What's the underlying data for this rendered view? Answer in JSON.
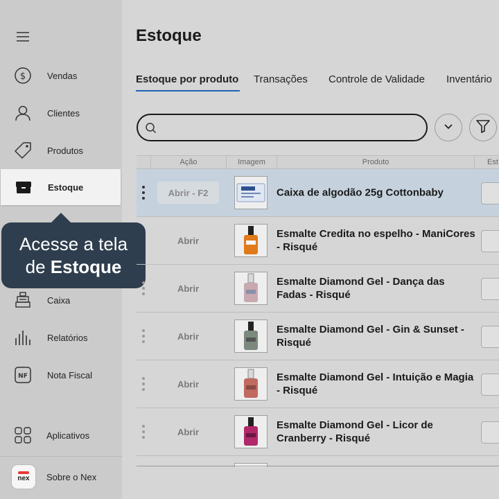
{
  "sidebar": {
    "menu_icon": "hamburger-icon",
    "items": [
      {
        "label": "Vendas",
        "icon": "dollar-circle-icon"
      },
      {
        "label": "Clientes",
        "icon": "user-icon"
      },
      {
        "label": "Produtos",
        "icon": "tag-icon"
      },
      {
        "label": "Estoque",
        "icon": "box-icon",
        "active": true
      },
      {
        "label": "Caixa",
        "icon": "cash-register-icon"
      },
      {
        "label": "Relatórios",
        "icon": "bar-chart-icon"
      },
      {
        "label": "Nota Fiscal",
        "icon": "nf-icon"
      }
    ],
    "apps_label": "Aplicativos",
    "about_label": "Sobre o Nex",
    "logo_text": "nex"
  },
  "tooltip": {
    "line1": "Acesse a tela",
    "line2_prefix": "de",
    "line2_strong": "Estoque"
  },
  "page": {
    "title": "Estoque",
    "tabs": [
      "Estoque por produto",
      "Transações",
      "Controle de Validade",
      "Inventário"
    ],
    "active_tab": 0
  },
  "search": {
    "placeholder": ""
  },
  "table": {
    "columns": [
      "Ação",
      "Imagem",
      "Produto",
      "Est"
    ],
    "rows": [
      {
        "action": "Abrir - F2",
        "product": "Caixa de algodão 25g Cottonbaby",
        "selected": true
      },
      {
        "action": "Abrir",
        "product": "Esmalte Credita no espelho - ManiCores - Risqué"
      },
      {
        "action": "Abrir",
        "product": "Esmalte Diamond Gel - Dança das Fadas - Risqué"
      },
      {
        "action": "Abrir",
        "product": "Esmalte Diamond Gel - Gin & Sunset - Risqué"
      },
      {
        "action": "Abrir",
        "product": "Esmalte Diamond Gel - Intuição e Magia - Risqué"
      },
      {
        "action": "Abrir",
        "product": "Esmalte Diamond Gel - Licor de Cranberry - Risqué"
      }
    ]
  },
  "colors": {
    "accent": "#1e63b6",
    "tooltip_bg": "#2f3e4e",
    "selected_row": "#c5d2de",
    "brand_red": "#e53935"
  }
}
